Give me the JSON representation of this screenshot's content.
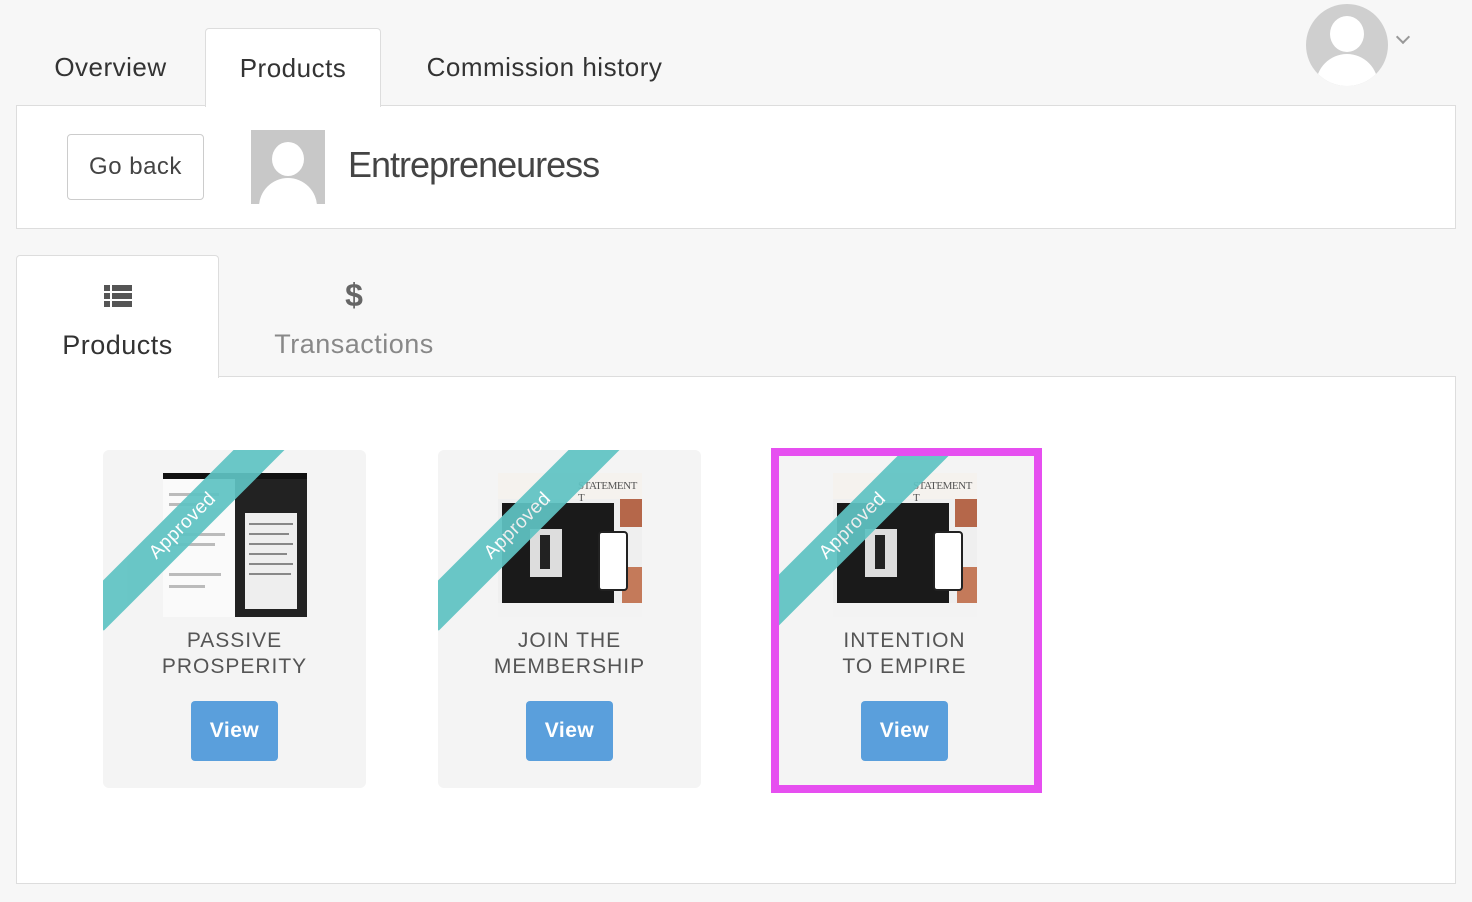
{
  "top_tabs": [
    {
      "label": "Overview"
    },
    {
      "label": "Products",
      "active": true
    },
    {
      "label": "Commission history"
    }
  ],
  "header": {
    "go_back_label": "Go back",
    "merchant_name": "Entrepreneuress"
  },
  "sub_tabs": [
    {
      "label": "Products",
      "icon": "list-icon",
      "active": true
    },
    {
      "label": "Transactions",
      "icon": "dollar-icon"
    }
  ],
  "sub_tab_icons": {
    "dollar": "$"
  },
  "products": [
    {
      "title_line1": "PASSIVE",
      "title_line2": "PROSPERITY",
      "status": "Approved",
      "button_label": "View"
    },
    {
      "title_line1": "JOIN THE",
      "title_line2": "MEMBERSHIP",
      "status": "Approved",
      "button_label": "View"
    },
    {
      "title_line1": "INTENTION",
      "title_line2": "TO EMPIRE",
      "status": "Approved",
      "button_label": "View",
      "highlighted": true
    }
  ],
  "thumb_text": {
    "statement": "STATEMENT T"
  },
  "colors": {
    "ribbon": "#5fc3c3",
    "view_button": "#5a9fdc",
    "highlight_border": "#e64ff0"
  }
}
